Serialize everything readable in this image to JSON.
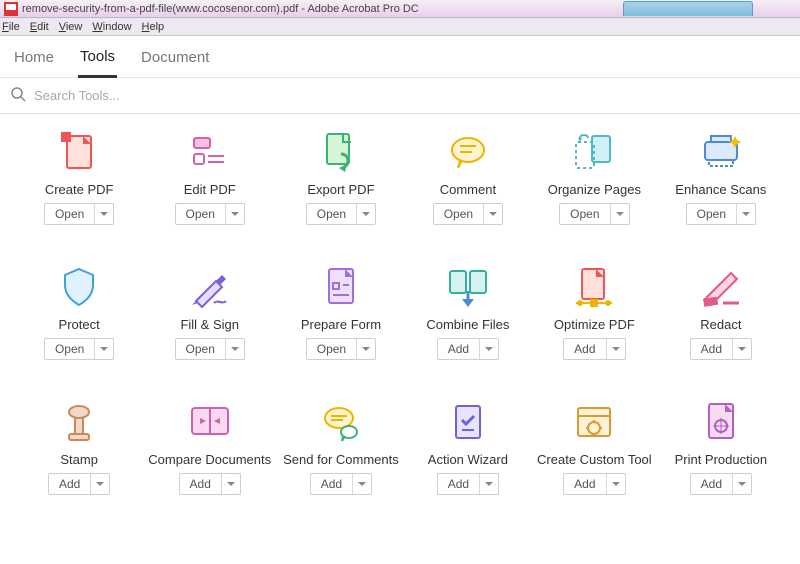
{
  "titlebar": {
    "title": "remove-security-from-a-pdf-file(www.cocosenor.com).pdf - Adobe Acrobat Pro DC"
  },
  "menubar": {
    "items": [
      "File",
      "Edit",
      "View",
      "Window",
      "Help"
    ]
  },
  "viewtabs": {
    "items": [
      "Home",
      "Tools",
      "Document"
    ],
    "active_index": 1
  },
  "search": {
    "placeholder": "Search Tools..."
  },
  "button_labels": {
    "open": "Open",
    "add": "Add"
  },
  "tools": [
    {
      "label": "Create PDF",
      "button": "open",
      "icon": "create-pdf"
    },
    {
      "label": "Edit PDF",
      "button": "open",
      "icon": "edit-pdf"
    },
    {
      "label": "Export PDF",
      "button": "open",
      "icon": "export-pdf"
    },
    {
      "label": "Comment",
      "button": "open",
      "icon": "comment"
    },
    {
      "label": "Organize Pages",
      "button": "open",
      "icon": "organize-pages"
    },
    {
      "label": "Enhance Scans",
      "button": "open",
      "icon": "enhance-scans"
    },
    {
      "label": "Protect",
      "button": "open",
      "icon": "protect"
    },
    {
      "label": "Fill & Sign",
      "button": "open",
      "icon": "fill-sign"
    },
    {
      "label": "Prepare Form",
      "button": "open",
      "icon": "prepare-form"
    },
    {
      "label": "Combine Files",
      "button": "add",
      "icon": "combine-files"
    },
    {
      "label": "Optimize PDF",
      "button": "add",
      "icon": "optimize-pdf"
    },
    {
      "label": "Redact",
      "button": "add",
      "icon": "redact"
    },
    {
      "label": "Stamp",
      "button": "add",
      "icon": "stamp"
    },
    {
      "label": "Compare Documents",
      "button": "add",
      "icon": "compare-docs"
    },
    {
      "label": "Send for Comments",
      "button": "add",
      "icon": "send-comments"
    },
    {
      "label": "Action Wizard",
      "button": "add",
      "icon": "action-wizard"
    },
    {
      "label": "Create Custom Tool",
      "button": "add",
      "icon": "custom-tool"
    },
    {
      "label": "Print Production",
      "button": "add",
      "icon": "print-prod"
    }
  ]
}
